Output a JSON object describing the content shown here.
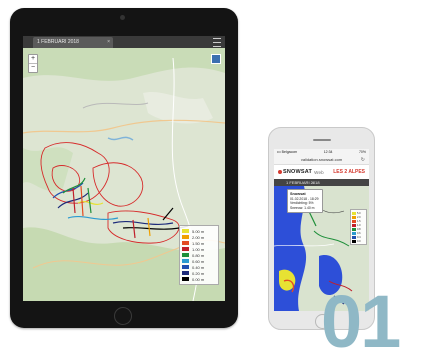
{
  "tablet": {
    "tab_title": "1 FEBRUARI 2018",
    "tab_close": "×",
    "legend": [
      {
        "label": "5.00 m",
        "color": "#e7e233"
      },
      {
        "label": "2.00 m",
        "color": "#f0a000"
      },
      {
        "label": "1.50 m",
        "color": "#e34b23"
      },
      {
        "label": "1.00 m",
        "color": "#c01f2b"
      },
      {
        "label": "0.80 m",
        "color": "#1f8f3a"
      },
      {
        "label": "0.60 m",
        "color": "#2b9ad0"
      },
      {
        "label": "0.40 m",
        "color": "#1f4fb0"
      },
      {
        "label": "0.20 m",
        "color": "#1c2a7a"
      },
      {
        "label": "0.00 m",
        "color": "#000000"
      }
    ],
    "zoom_in": "+",
    "zoom_out": "−"
  },
  "phone": {
    "status_left": "••• Belgacom",
    "status_time": "12:34",
    "status_right": "70%",
    "url": "validation.snowsat.com",
    "reload_icon": "↻",
    "brand_text": "SNOWSAT",
    "brand_suffix": "Web",
    "resort": "LES 2 ALPES",
    "tab_title": "1 FEBRUARI 2018",
    "tab_close": "×",
    "popup": {
      "title": "Snowsat",
      "lines": [
        "01.02.2018 - 18:29",
        "Verdichting: 5%",
        "Sneeuw: 1.40 m"
      ]
    },
    "legend": [
      {
        "label": "5.0",
        "color": "#e7e233"
      },
      {
        "label": "2.0",
        "color": "#f0a000"
      },
      {
        "label": "1.5",
        "color": "#e34b23"
      },
      {
        "label": "1.0",
        "color": "#c01f2b"
      },
      {
        "label": "0.8",
        "color": "#1f8f3a"
      },
      {
        "label": "0.6",
        "color": "#2b9ad0"
      },
      {
        "label": "0.4",
        "color": "#1f4fb0"
      },
      {
        "label": "0.0",
        "color": "#000000"
      }
    ]
  },
  "number": "01",
  "colors": {
    "accent_number": "#8fb8c6",
    "brand_red": "#d43a2f"
  }
}
